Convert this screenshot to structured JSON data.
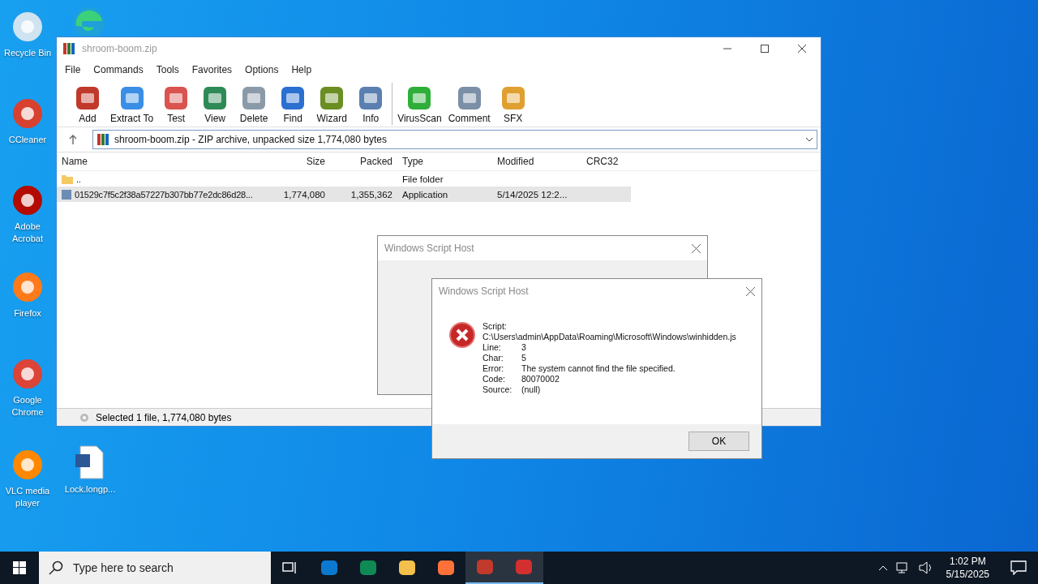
{
  "desktop_icons": [
    {
      "label": "Recycle Bin"
    },
    {
      "label": "CCleaner"
    },
    {
      "label": "Adobe Acrobat"
    },
    {
      "label": "Firefox"
    },
    {
      "label": "Google Chrome"
    },
    {
      "label": "VLC media player"
    }
  ],
  "desktop_file": {
    "label": "Lock.longp..."
  },
  "winrar": {
    "title": "shroom-boom.zip",
    "menu": [
      "File",
      "Commands",
      "Tools",
      "Favorites",
      "Options",
      "Help"
    ],
    "toolbar": [
      "Add",
      "Extract To",
      "Test",
      "View",
      "Delete",
      "Find",
      "Wizard",
      "Info",
      "VirusScan",
      "Comment",
      "SFX"
    ],
    "address": "shroom-boom.zip - ZIP archive, unpacked size 1,774,080 bytes",
    "columns": [
      "Name",
      "Size",
      "Packed",
      "Type",
      "Modified",
      "CRC32"
    ],
    "rows": [
      {
        "name": "..",
        "size": "",
        "packed": "",
        "type": "File folder",
        "modified": "",
        "selected": false
      },
      {
        "name": "01529c7f5c2f38a57227b307bb77e2dc86d28...",
        "size": "1,774,080",
        "packed": "1,355,362",
        "type": "Application",
        "modified": "5/14/2025 12:2...",
        "selected": true
      }
    ],
    "status": "Selected 1 file, 1,774,080 bytes"
  },
  "dialog_back": {
    "title": "Windows Script Host"
  },
  "dialog": {
    "title": "Windows Script Host",
    "fields": [
      {
        "label": "Script:",
        "value": "C:\\Users\\admin\\AppData\\Roaming\\Microsoft\\Windows\\winhidden.js"
      },
      {
        "label": "Line:",
        "value": "3"
      },
      {
        "label": "Char:",
        "value": "5"
      },
      {
        "label": "Error:",
        "value": "The system cannot find the file specified."
      },
      {
        "label": "Code:",
        "value": "80070002"
      },
      {
        "label": "Source:",
        "value": "(null)"
      }
    ],
    "button": "OK"
  },
  "taskbar": {
    "search_placeholder": "Type here to search",
    "apps": [
      {
        "selected": false
      },
      {
        "selected": false
      },
      {
        "selected": false
      },
      {
        "selected": false
      },
      {
        "selected": true
      },
      {
        "selected": true
      }
    ],
    "time": "1:02 PM",
    "date": "5/15/2025"
  }
}
